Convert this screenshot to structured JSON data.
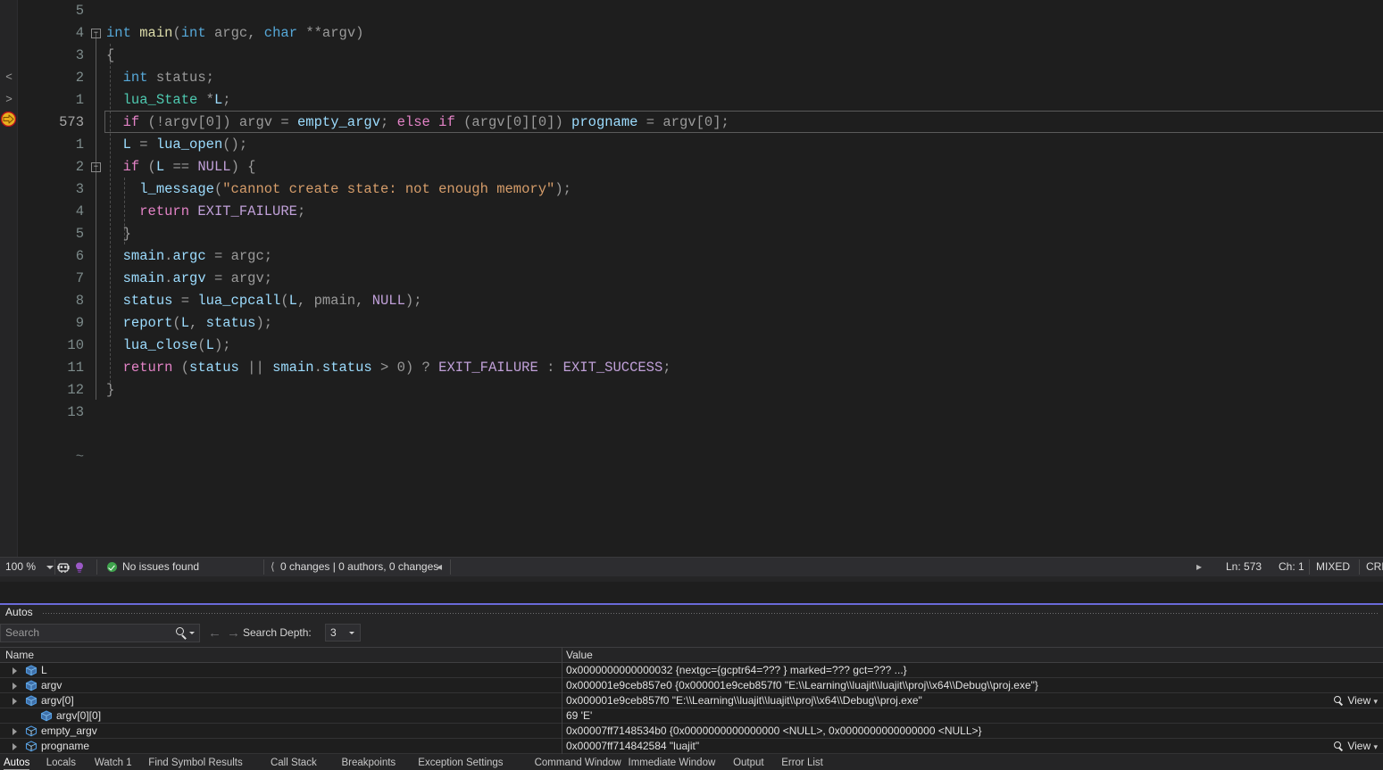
{
  "editor": {
    "gutter": {
      "nav_prev": "<",
      "nav_next": ">",
      "exec_pointer": "execution-pointer-arrow"
    },
    "eof_marker": "~",
    "current_line_number": "573",
    "lines": [
      {
        "num": "5",
        "fold": "",
        "tokens": []
      },
      {
        "num": "4",
        "fold": "-",
        "tokens": [
          {
            "t": "int",
            "c": "typ"
          },
          {
            "t": " ",
            "c": "pun"
          },
          {
            "t": "main",
            "c": "fn"
          },
          {
            "t": "(",
            "c": "pun"
          },
          {
            "t": "int",
            "c": "typ"
          },
          {
            "t": " ",
            "c": "pun"
          },
          {
            "t": "argc",
            "c": "id"
          },
          {
            "t": ", ",
            "c": "pun"
          },
          {
            "t": "char",
            "c": "typ"
          },
          {
            "t": " **",
            "c": "pun"
          },
          {
            "t": "argv",
            "c": "id"
          },
          {
            "t": ")",
            "c": "pun"
          }
        ]
      },
      {
        "num": "3",
        "fold": "",
        "tokens": [
          {
            "t": "{",
            "c": "pun"
          }
        ]
      },
      {
        "num": "2",
        "fold": "",
        "tokens": [
          {
            "t": "  ",
            "c": "pun"
          },
          {
            "t": "int",
            "c": "typ"
          },
          {
            "t": " ",
            "c": "pun"
          },
          {
            "t": "status",
            "c": "id"
          },
          {
            "t": ";",
            "c": "pun"
          }
        ]
      },
      {
        "num": "1",
        "fold": "",
        "tokens": [
          {
            "t": "  ",
            "c": "pun"
          },
          {
            "t": "lua_State",
            "c": "udt"
          },
          {
            "t": " *",
            "c": "pun"
          },
          {
            "t": "L",
            "c": "var"
          },
          {
            "t": ";",
            "c": "pun"
          }
        ]
      },
      {
        "num": "573",
        "fold": "",
        "current": true,
        "tokens": [
          {
            "t": "  ",
            "c": "pun"
          },
          {
            "t": "if",
            "c": "kw"
          },
          {
            "t": " (!",
            "c": "pun"
          },
          {
            "t": "argv",
            "c": "id"
          },
          {
            "t": "[",
            "c": "pun"
          },
          {
            "t": "0",
            "c": "id"
          },
          {
            "t": "]) ",
            "c": "pun"
          },
          {
            "t": "argv",
            "c": "id"
          },
          {
            "t": " = ",
            "c": "pun"
          },
          {
            "t": "empty_argv",
            "c": "var"
          },
          {
            "t": "; ",
            "c": "pun"
          },
          {
            "t": "else",
            "c": "kw"
          },
          {
            "t": " ",
            "c": "pun"
          },
          {
            "t": "if",
            "c": "kw"
          },
          {
            "t": " (",
            "c": "pun"
          },
          {
            "t": "argv",
            "c": "id"
          },
          {
            "t": "[",
            "c": "pun"
          },
          {
            "t": "0",
            "c": "id"
          },
          {
            "t": "][",
            "c": "pun"
          },
          {
            "t": "0",
            "c": "id"
          },
          {
            "t": "]) ",
            "c": "pun"
          },
          {
            "t": "progname",
            "c": "var"
          },
          {
            "t": " = ",
            "c": "pun"
          },
          {
            "t": "argv",
            "c": "id"
          },
          {
            "t": "[",
            "c": "pun"
          },
          {
            "t": "0",
            "c": "id"
          },
          {
            "t": "];",
            "c": "pun"
          }
        ]
      },
      {
        "num": "1",
        "fold": "",
        "tokens": [
          {
            "t": "  ",
            "c": "pun"
          },
          {
            "t": "L",
            "c": "var"
          },
          {
            "t": " = ",
            "c": "pun"
          },
          {
            "t": "lua_open",
            "c": "var"
          },
          {
            "t": "();",
            "c": "pun"
          }
        ]
      },
      {
        "num": "2",
        "fold": "-",
        "tokens": [
          {
            "t": "  ",
            "c": "pun"
          },
          {
            "t": "if",
            "c": "kw"
          },
          {
            "t": " (",
            "c": "pun"
          },
          {
            "t": "L",
            "c": "var"
          },
          {
            "t": " == ",
            "c": "pun"
          },
          {
            "t": "NULL",
            "c": "mac"
          },
          {
            "t": ") {",
            "c": "pun"
          }
        ]
      },
      {
        "num": "3",
        "fold": "",
        "tokens": [
          {
            "t": "    ",
            "c": "pun"
          },
          {
            "t": "l_message",
            "c": "var"
          },
          {
            "t": "(",
            "c": "pun"
          },
          {
            "t": "\"cannot create state: not enough memory\"",
            "c": "str"
          },
          {
            "t": ");",
            "c": "pun"
          }
        ]
      },
      {
        "num": "4",
        "fold": "",
        "tokens": [
          {
            "t": "    ",
            "c": "pun"
          },
          {
            "t": "return",
            "c": "kw"
          },
          {
            "t": " ",
            "c": "pun"
          },
          {
            "t": "EXIT_FAILURE",
            "c": "mac"
          },
          {
            "t": ";",
            "c": "pun"
          }
        ]
      },
      {
        "num": "5",
        "fold": "",
        "tokens": [
          {
            "t": "  }",
            "c": "pun"
          }
        ]
      },
      {
        "num": "6",
        "fold": "",
        "tokens": [
          {
            "t": "  ",
            "c": "pun"
          },
          {
            "t": "smain",
            "c": "var"
          },
          {
            "t": ".",
            "c": "pun"
          },
          {
            "t": "argc",
            "c": "var"
          },
          {
            "t": " = ",
            "c": "pun"
          },
          {
            "t": "argc",
            "c": "id"
          },
          {
            "t": ";",
            "c": "pun"
          }
        ]
      },
      {
        "num": "7",
        "fold": "",
        "tokens": [
          {
            "t": "  ",
            "c": "pun"
          },
          {
            "t": "smain",
            "c": "var"
          },
          {
            "t": ".",
            "c": "pun"
          },
          {
            "t": "argv",
            "c": "var"
          },
          {
            "t": " = ",
            "c": "pun"
          },
          {
            "t": "argv",
            "c": "id"
          },
          {
            "t": ";",
            "c": "pun"
          }
        ]
      },
      {
        "num": "8",
        "fold": "",
        "tokens": [
          {
            "t": "  ",
            "c": "pun"
          },
          {
            "t": "status",
            "c": "var"
          },
          {
            "t": " = ",
            "c": "pun"
          },
          {
            "t": "lua_cpcall",
            "c": "var"
          },
          {
            "t": "(",
            "c": "pun"
          },
          {
            "t": "L",
            "c": "var"
          },
          {
            "t": ", ",
            "c": "pun"
          },
          {
            "t": "pmain",
            "c": "id"
          },
          {
            "t": ", ",
            "c": "pun"
          },
          {
            "t": "NULL",
            "c": "mac"
          },
          {
            "t": ");",
            "c": "pun"
          }
        ]
      },
      {
        "num": "9",
        "fold": "",
        "tokens": [
          {
            "t": "  ",
            "c": "pun"
          },
          {
            "t": "report",
            "c": "var"
          },
          {
            "t": "(",
            "c": "pun"
          },
          {
            "t": "L",
            "c": "var"
          },
          {
            "t": ", ",
            "c": "pun"
          },
          {
            "t": "status",
            "c": "var"
          },
          {
            "t": ");",
            "c": "pun"
          }
        ]
      },
      {
        "num": "10",
        "fold": "",
        "tokens": [
          {
            "t": "  ",
            "c": "pun"
          },
          {
            "t": "lua_close",
            "c": "var"
          },
          {
            "t": "(",
            "c": "pun"
          },
          {
            "t": "L",
            "c": "var"
          },
          {
            "t": ");",
            "c": "pun"
          }
        ]
      },
      {
        "num": "11",
        "fold": "",
        "tokens": [
          {
            "t": "  ",
            "c": "pun"
          },
          {
            "t": "return",
            "c": "kw"
          },
          {
            "t": " (",
            "c": "pun"
          },
          {
            "t": "status",
            "c": "var"
          },
          {
            "t": " || ",
            "c": "pun"
          },
          {
            "t": "smain",
            "c": "var"
          },
          {
            "t": ".",
            "c": "pun"
          },
          {
            "t": "status",
            "c": "var"
          },
          {
            "t": " > ",
            "c": "pun"
          },
          {
            "t": "0",
            "c": "id"
          },
          {
            "t": ") ? ",
            "c": "pun"
          },
          {
            "t": "EXIT_FAILURE",
            "c": "mac"
          },
          {
            "t": " : ",
            "c": "pun"
          },
          {
            "t": "EXIT_SUCCESS",
            "c": "mac"
          },
          {
            "t": ";",
            "c": "pun"
          }
        ]
      },
      {
        "num": "12",
        "fold": "",
        "tokens": [
          {
            "t": "}",
            "c": "pun"
          }
        ]
      },
      {
        "num": "13",
        "fold": "",
        "tokens": []
      }
    ]
  },
  "status_bar": {
    "zoom": "100 %",
    "debug_icon": "debug-robot-icon",
    "bulb_icon": "lightbulb-icon",
    "issues": "No issues found",
    "changes": "0 changes | 0 authors, 0 changes",
    "line": "Ln: 573",
    "char": "Ch: 1",
    "encoding_mode": "MIXED",
    "line_endings": "CRL"
  },
  "autos": {
    "title": "Autos",
    "search": {
      "placeholder": "Search",
      "value": ""
    },
    "search_depth_label": "Search Depth:",
    "search_depth_value": "3",
    "columns": {
      "name": "Name",
      "value": "Value"
    },
    "rows": [
      {
        "name": "L",
        "depth": 0,
        "expandable": true,
        "icon": "variable-cube-icon",
        "value": "0x0000000000000032 {nextgc={gcptr64=??? } marked=??? gct=??? ...}",
        "view": ""
      },
      {
        "name": "argv",
        "depth": 0,
        "expandable": true,
        "icon": "variable-cube-icon",
        "value": "0x000001e9ceb857e0 {0x000001e9ceb857f0 \"E:\\\\Learning\\\\luajit\\\\luajit\\\\proj\\\\x64\\\\Debug\\\\proj.exe\"}",
        "view": ""
      },
      {
        "name": "argv[0]",
        "depth": 0,
        "expandable": true,
        "icon": "variable-cube-icon",
        "value": "0x000001e9ceb857f0 \"E:\\\\Learning\\\\luajit\\\\luajit\\\\proj\\\\x64\\\\Debug\\\\proj.exe\"",
        "view": "View"
      },
      {
        "name": "argv[0][0]",
        "depth": 1,
        "expandable": false,
        "icon": "variable-cube-icon",
        "value": "69 'E'",
        "view": ""
      },
      {
        "name": "empty_argv",
        "depth": 0,
        "expandable": true,
        "icon": "array-cube-icon",
        "value": "0x00007ff7148534b0 {0x0000000000000000 <NULL>, 0x0000000000000000 <NULL>}",
        "view": ""
      },
      {
        "name": "progname",
        "depth": 0,
        "expandable": true,
        "icon": "array-cube-icon",
        "value": "0x00007ff714842584 \"luajit\"",
        "view": "View"
      }
    ]
  },
  "bottom_tabs": [
    {
      "label": "Autos",
      "active": true
    },
    {
      "label": "Locals",
      "active": false
    },
    {
      "label": "Watch 1",
      "active": false
    },
    {
      "label": "Find Symbol Results",
      "active": false
    },
    {
      "label": "Call Stack",
      "active": false
    },
    {
      "label": "Breakpoints",
      "active": false
    },
    {
      "label": "Exception Settings",
      "active": false
    },
    {
      "label": "Command Window",
      "active": false
    },
    {
      "label": "Immediate Window",
      "active": false
    },
    {
      "label": "Output",
      "active": false
    },
    {
      "label": "Error List",
      "active": false
    }
  ],
  "colors": {
    "editor_bg": "#1e1e1e",
    "chrome_bg": "#252526",
    "statusbar_bg": "#2d2d30",
    "accent": "#6a6ad8",
    "keyword": "#e383c6",
    "type": "#56a8d8",
    "user_type": "#4ec9b0",
    "string": "#d69d6a",
    "macro": "#c0a0d8",
    "identifier": "#9a9a9a",
    "variable": "#9cdcfe",
    "ok_green": "#3fa34d",
    "exec_arrow": "#e8b020"
  }
}
